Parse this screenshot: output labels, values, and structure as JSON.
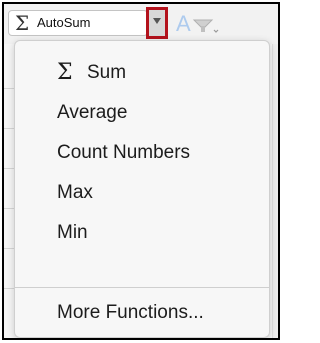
{
  "toolbar": {
    "autosum_label": "AutoSum",
    "autosum_icon": "sigma-icon",
    "dropdown_icon": "chevron-down-icon",
    "format_letter": "A",
    "clear_icon": "eraser-icon",
    "highlight_color": "#b3121c"
  },
  "menu": {
    "items": [
      {
        "label": "Sum",
        "icon": "sigma-icon"
      },
      {
        "label": "Average"
      },
      {
        "label": "Count Numbers"
      },
      {
        "label": "Max"
      },
      {
        "label": "Min"
      }
    ],
    "more_label": "More Functions..."
  }
}
